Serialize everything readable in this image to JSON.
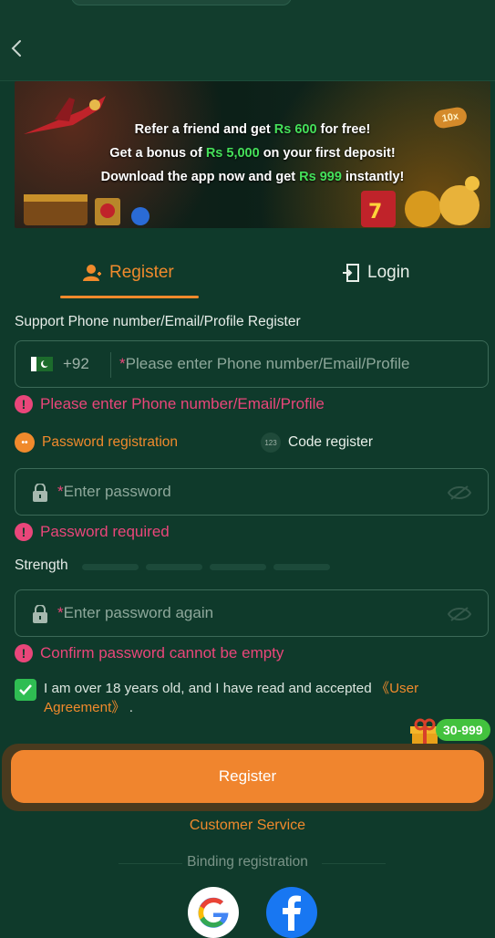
{
  "banner": {
    "line1_pre": "Refer a friend and get ",
    "line1_hl": "Rs 600",
    "line1_post": " for free!",
    "line2_pre": "Get a bonus of ",
    "line2_hl": "Rs 5,000",
    "line2_post": " on your first deposit!",
    "line3_pre": "Download the app now and get ",
    "line3_hl": "Rs 999",
    "line3_post": " instantly!",
    "badge": "10x"
  },
  "tabs": {
    "register": "Register",
    "login": "Login"
  },
  "form": {
    "section_label": "Support Phone number/Email/Profile Register",
    "country_code": "+92",
    "phone_placeholder": "Please enter Phone number/Email/Profile",
    "phone_error": "Please enter Phone number/Email/Profile",
    "mode_password": "Password registration",
    "mode_code": "Code register",
    "mode_code_icon_text": "123",
    "password_placeholder": "Enter password",
    "password_error": "Password required",
    "strength_label": "Strength",
    "password2_placeholder": "Enter password again",
    "password2_error": "Confirm password cannot be empty",
    "required_mark": "*",
    "error_mark": "!",
    "agree_text": "I am over 18 years old, and I have read and accepted ",
    "agree_link": "《User Agreement》",
    "agree_end": " .",
    "gift_badge": "30-999",
    "register_button": "Register",
    "customer_service": "Customer Service",
    "binding_label": "Binding registration"
  },
  "colors": {
    "accent": "#f08a2c",
    "error": "#e9467a",
    "bg": "#0f3a2b",
    "check": "#2fbd52"
  },
  "icons": [
    "back-icon",
    "register-user-icon",
    "login-door-icon",
    "pakistan-flag-icon",
    "lock-icon",
    "eye-off-icon",
    "error-icon",
    "checkbox-icon",
    "gift-icon",
    "google-icon",
    "facebook-icon"
  ]
}
